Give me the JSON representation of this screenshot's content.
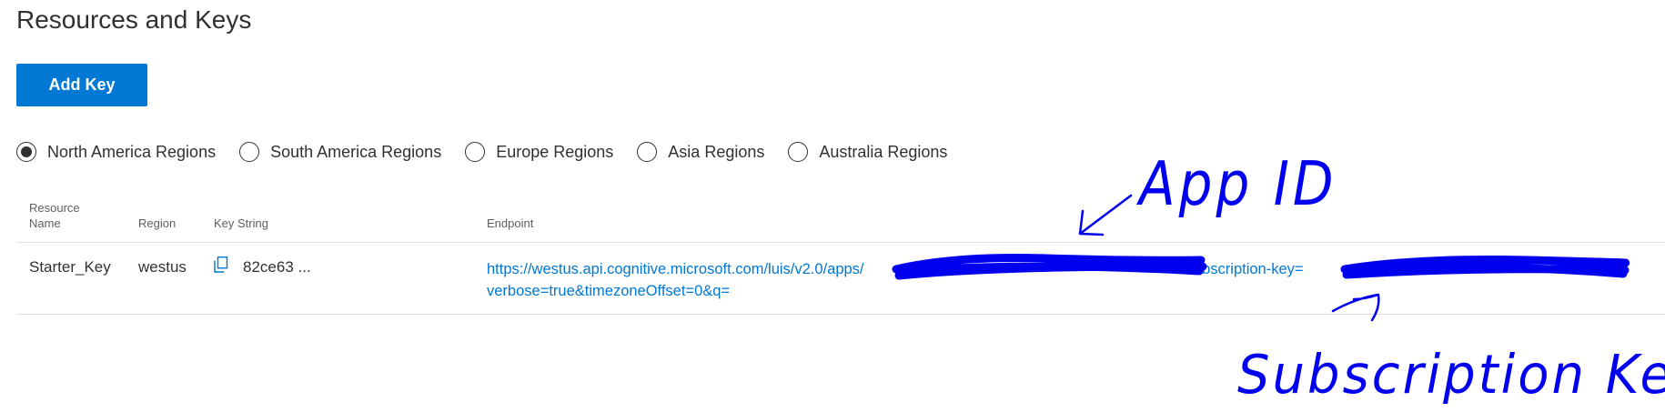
{
  "page": {
    "title": "Resources and Keys"
  },
  "toolbar": {
    "add_key_label": "Add Key"
  },
  "regions": {
    "selected": "North America Regions",
    "options": [
      "North America Regions",
      "South America Regions",
      "Europe Regions",
      "Asia Regions",
      "Australia Regions"
    ]
  },
  "table": {
    "headers": {
      "resource_name": "Resource Name",
      "region": "Region",
      "key_string": "Key String",
      "endpoint": "Endpoint"
    },
    "rows": [
      {
        "resource_name": "Starter_Key",
        "region": "westus",
        "key_string": "82ce63 ...",
        "endpoint_part1": "https://westus.api.cognitive.microsoft.com/luis/v2.0/apps/",
        "endpoint_part2": "?subscription-key=",
        "endpoint_part3": "&",
        "endpoint_line2": "verbose=true&timezoneOffset=0&q="
      }
    ]
  },
  "annotations": {
    "app_id": "App ID",
    "subscription_key": "Subscription Key",
    "ink_color": "#0000ee"
  },
  "colors": {
    "accent": "#0078d4",
    "text": "#323130",
    "muted": "#605e5c",
    "divider": "#e1dfdd"
  },
  "icons": {
    "copy": "copy-icon",
    "radio_selected": "radio-selected-icon",
    "radio_unselected": "radio-unselected-icon"
  }
}
